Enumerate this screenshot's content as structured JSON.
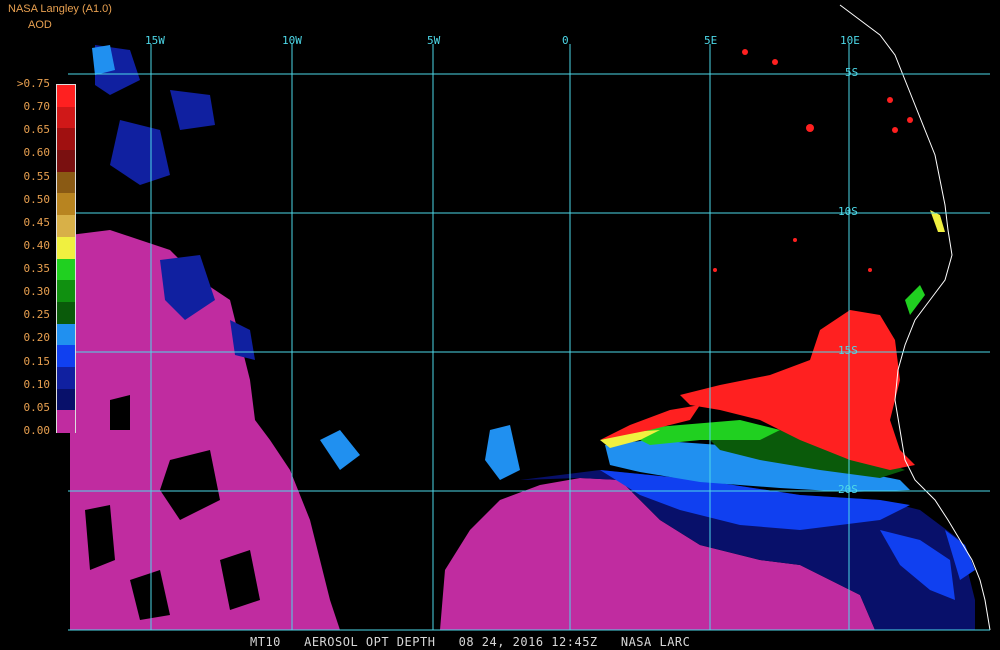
{
  "header": {
    "title": "NASA Langley (A1.0)",
    "unit": "AOD"
  },
  "legend": {
    "labels": [
      ">0.75",
      "0.70",
      "0.65",
      "0.60",
      "0.55",
      "0.50",
      "0.45",
      "0.40",
      "0.35",
      "0.30",
      "0.25",
      "0.20",
      "0.15",
      "0.10",
      "0.05",
      "0.00"
    ],
    "colors": [
      "#ff2020",
      "#d01818",
      "#a01010",
      "#7a1010",
      "#8a5a14",
      "#b88420",
      "#d8b048",
      "#f0f040",
      "#20d020",
      "#109010",
      "#0a5a0a",
      "#2090f0",
      "#1040f0",
      "#1020a0",
      "#08106a",
      "#c02ca0"
    ]
  },
  "longitudes": [
    "15W",
    "10W",
    "5W",
    "0",
    "5E",
    "10E"
  ],
  "latitudes": [
    "5S",
    "10S",
    "15S",
    "20S"
  ],
  "footer": {
    "product": "MT10",
    "field": "AEROSOL OPT DEPTH",
    "datetime": "08 24, 2016 12:45Z",
    "source": "NASA LARC"
  },
  "colors": {
    "grid": "#4dd8e8",
    "coast": "#ffffff",
    "label_orange": "#e8a050",
    "background": "#000000"
  }
}
